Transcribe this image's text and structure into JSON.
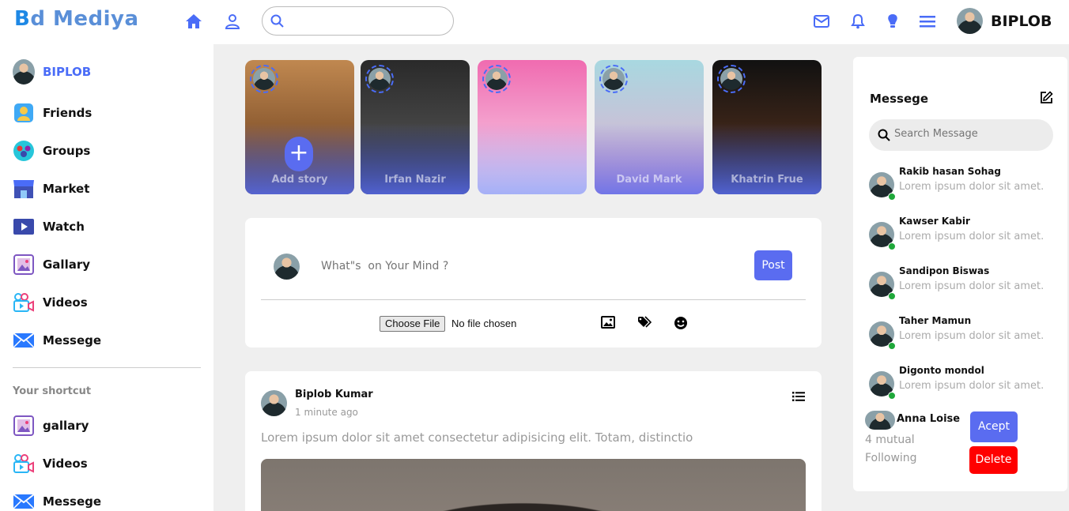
{
  "app": {
    "logo_text": "d Mediya",
    "logo_letter": "B"
  },
  "header": {
    "search_placeholder": "",
    "user_name": "BIPLOB",
    "icons": [
      "home-icon",
      "user-icon",
      "search-icon",
      "mail-icon",
      "bell-icon",
      "bulb-icon",
      "menu-icon"
    ],
    "accent_color": "#4a6cf7"
  },
  "sidebar": {
    "profile_name": "BIPLOB",
    "items": [
      {
        "label": "Friends",
        "icon": "friends-icon"
      },
      {
        "label": "Groups",
        "icon": "groups-icon"
      },
      {
        "label": "Market",
        "icon": "market-icon"
      },
      {
        "label": "Watch",
        "icon": "watch-icon"
      },
      {
        "label": "Gallary",
        "icon": "gallery-icon"
      },
      {
        "label": "Videos",
        "icon": "videos-icon"
      },
      {
        "label": "Messege",
        "icon": "message-icon"
      }
    ],
    "shortcut_title": "Your shortcut",
    "shortcuts": [
      {
        "label": "gallary",
        "icon": "gallery-icon"
      },
      {
        "label": "Videos",
        "icon": "videos-icon"
      },
      {
        "label": "Messege",
        "icon": "message-icon"
      }
    ]
  },
  "stories": [
    {
      "name": "Add story",
      "add_symbol": "+"
    },
    {
      "name": "Irfan Nazir"
    },
    {
      "name": ""
    },
    {
      "name": "David Mark"
    },
    {
      "name": "Khatrin Frue"
    }
  ],
  "create_post": {
    "placeholder": "What\"s  on Your Mind ?",
    "post_label": "Post",
    "file_button": "Choose File",
    "file_status": "No file chosen"
  },
  "feed": {
    "author": "Biplob Kumar",
    "time": "1 minute ago",
    "text": "Lorem ipsum dolor sit amet consectetur adipisicing elit. Totam, distinctio"
  },
  "messages": {
    "title": "Messege",
    "search_placeholder": "Search Message",
    "contacts": [
      {
        "name": "Rakib hasan Sohag",
        "preview": "Lorem ipsum dolor sit amet."
      },
      {
        "name": "Kawser Kabir",
        "preview": "Lorem ipsum dolor sit amet."
      },
      {
        "name": "Sandipon Biswas",
        "preview": "Lorem ipsum dolor sit amet."
      },
      {
        "name": "Taher Mamun",
        "preview": "Lorem ipsum dolor sit amet."
      },
      {
        "name": "Digonto mondol",
        "preview": "Lorem ipsum dolor sit amet."
      }
    ]
  },
  "friend_request": {
    "name": "Anna Loise",
    "mutual": "4 mutual",
    "following": "Following",
    "accept_label": "Acept",
    "delete_label": "Delete"
  }
}
